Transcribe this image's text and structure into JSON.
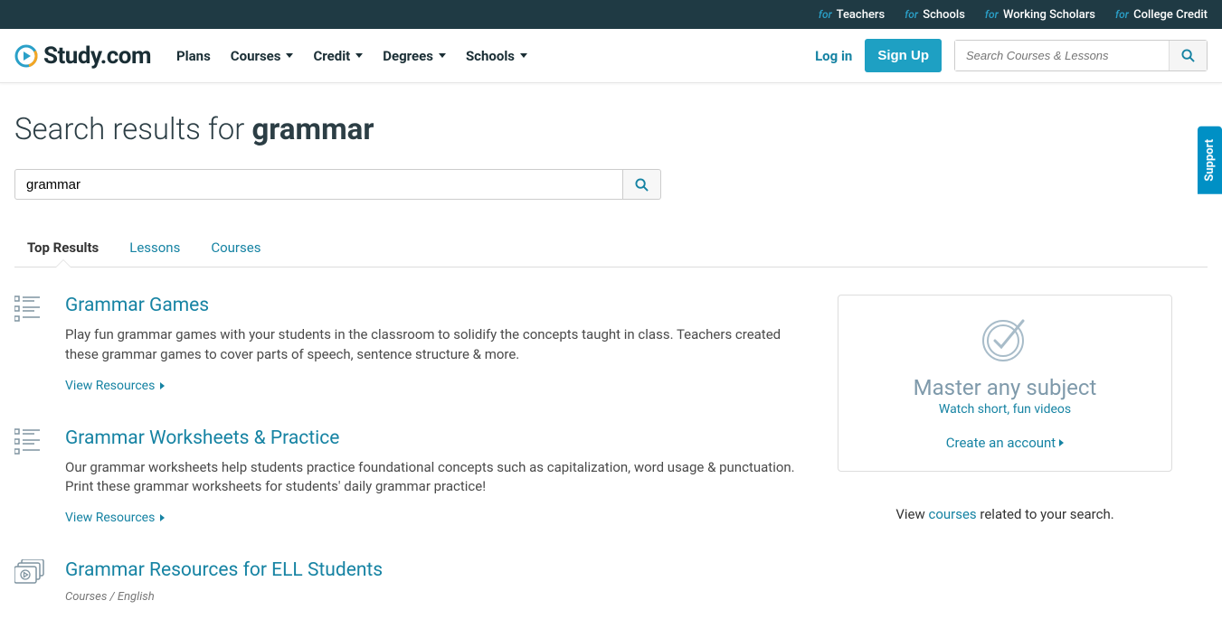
{
  "topbar": {
    "for_label": "for",
    "links": [
      "Teachers",
      "Schools",
      "Working Scholars",
      "College Credit"
    ]
  },
  "logo": {
    "text": "Study.com"
  },
  "nav": {
    "plans": "Plans",
    "courses": "Courses",
    "credit": "Credit",
    "degrees": "Degrees",
    "schools": "Schools"
  },
  "auth": {
    "login": "Log in",
    "signup": "Sign Up"
  },
  "header_search": {
    "placeholder": "Search Courses & Lessons"
  },
  "page": {
    "title_prefix": "Search results for ",
    "query": "grammar"
  },
  "main_search": {
    "value": "grammar"
  },
  "tabs": {
    "top": "Top Results",
    "lessons": "Lessons",
    "courses": "Courses"
  },
  "results": [
    {
      "title": "Grammar Games",
      "desc": "Play fun grammar games with your students in the classroom to solidify the concepts taught in class. Teachers created these grammar games to cover parts of speech, sentence structure & more.",
      "cta": "View Resources",
      "icon": "list"
    },
    {
      "title": "Grammar Worksheets & Practice",
      "desc": "Our grammar worksheets help students practice foundational concepts such as capitalization, word usage & punctuation. Print these grammar worksheets for students' daily grammar practice!",
      "cta": "View Resources",
      "icon": "list"
    },
    {
      "title": "Grammar Resources for ELL Students",
      "breadcrumb": "Courses / English",
      "icon": "video"
    }
  ],
  "promo": {
    "heading": "Master any subject",
    "sub": "Watch short, fun videos",
    "cta": "Create an account"
  },
  "related": {
    "prefix": "View ",
    "link": "courses",
    "suffix": " related to your search."
  },
  "support": "Support"
}
